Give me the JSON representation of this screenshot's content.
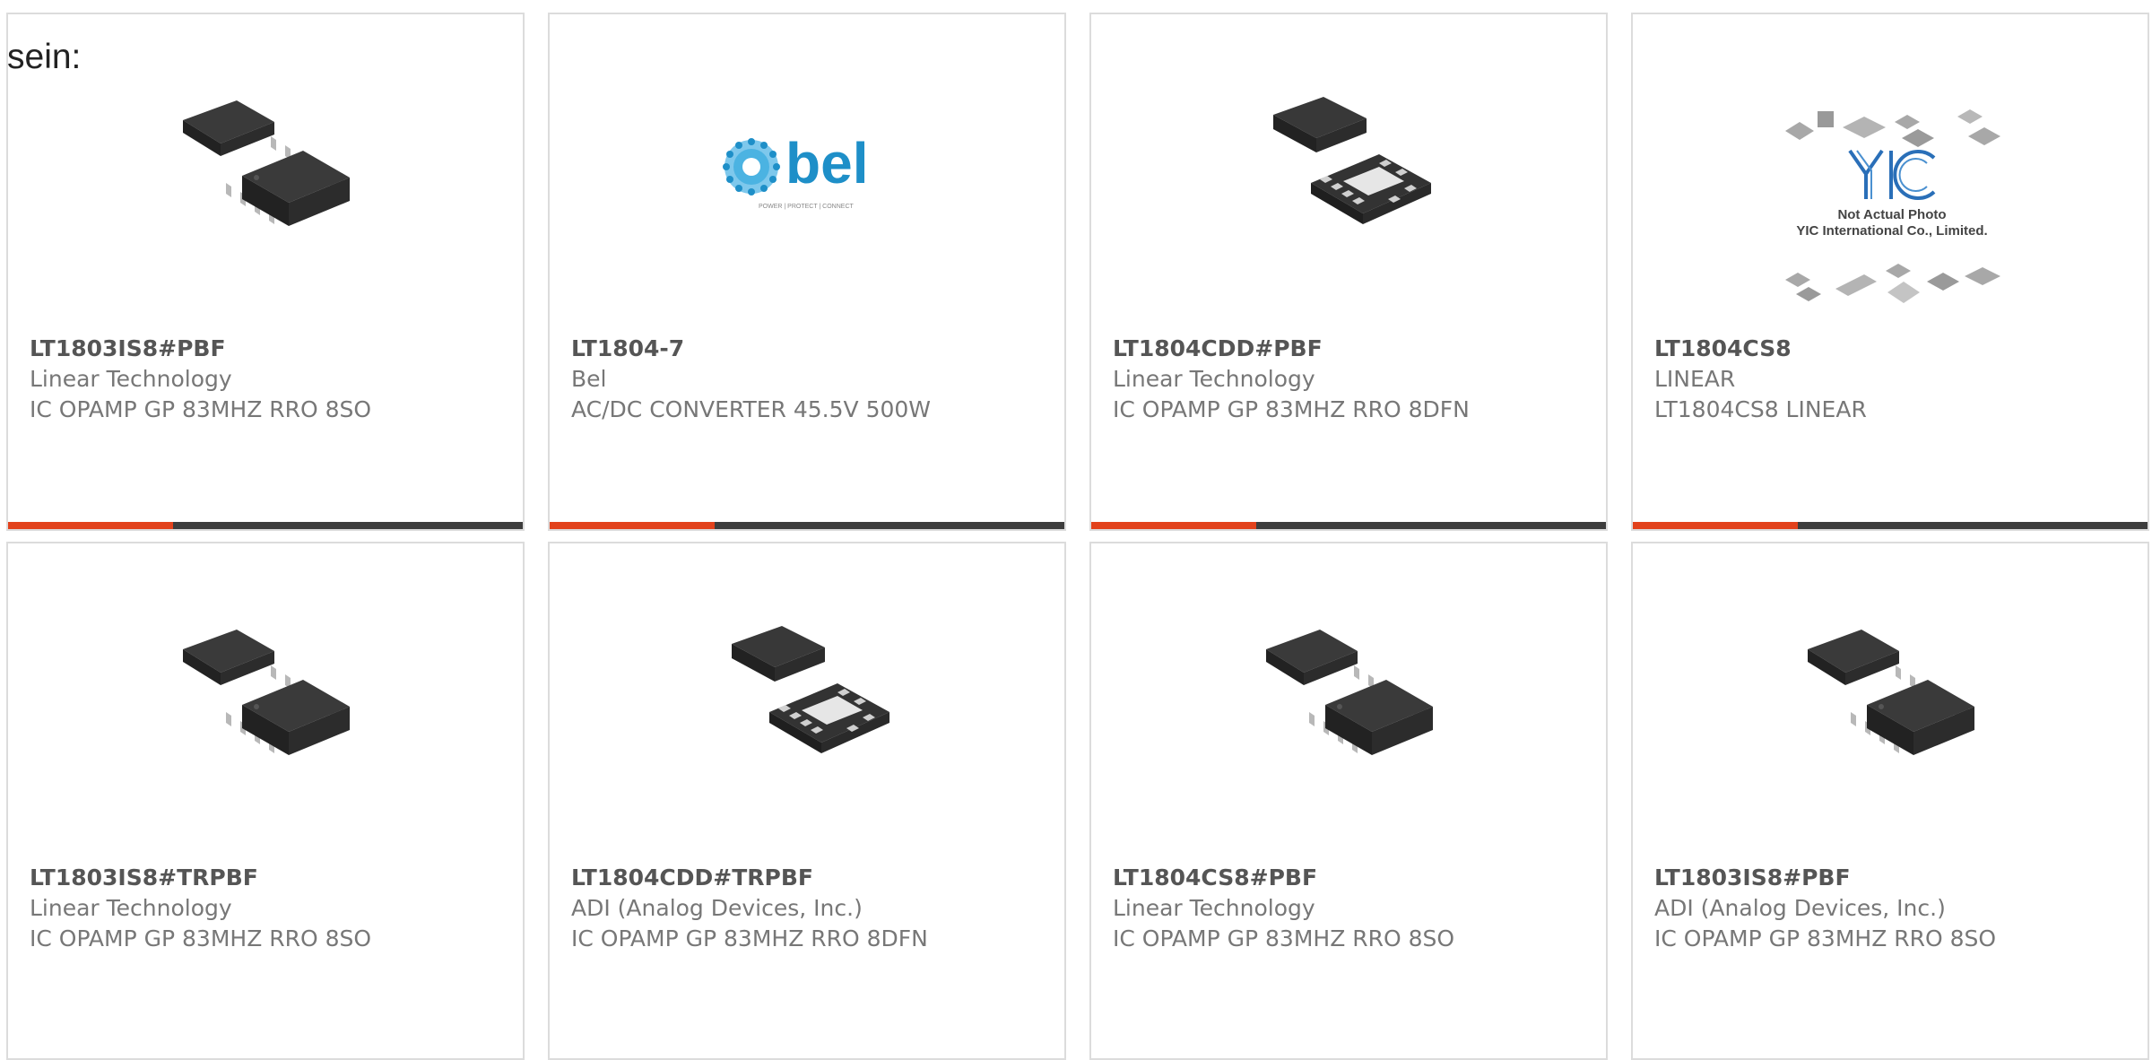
{
  "lead_text": "sein:",
  "accent_color": "#e2421c",
  "bar_color": "#3d3d3d",
  "products": [
    {
      "part": "LT1803IS8#PBF",
      "maker": "Linear Technology",
      "desc": "IC OPAMP GP 83MHZ RRO 8SO",
      "image": "soic-8-chip-icon",
      "bar_fill": 0.32
    },
    {
      "part": "LT1804-7",
      "maker": "Bel",
      "desc": "AC/DC CONVERTER 45.5V 500W",
      "image": "bel-logo",
      "logo_text": "bel",
      "logo_tagline": "POWER | PROTECT | CONNECT",
      "bar_fill": 0.32
    },
    {
      "part": "LT1804CDD#PBF",
      "maker": "Linear Technology",
      "desc": "IC OPAMP GP 83MHZ RRO 8DFN",
      "image": "dfn-8-chip-icon",
      "bar_fill": 0.32
    },
    {
      "part": "LT1804CS8",
      "maker": "LINEAR",
      "desc": "LT1804CS8 LINEAR",
      "image": "yic-placeholder-image",
      "logo_text": "YIC",
      "photo_caption_1": "Not Actual Photo",
      "photo_caption_2": "YIC International Co., Limited.",
      "bar_fill": 0.32
    },
    {
      "part": "LT1803IS8#TRPBF",
      "maker": "Linear Technology",
      "desc": "IC OPAMP GP 83MHZ RRO 8SO",
      "image": "soic-8-chip-icon"
    },
    {
      "part": "LT1804CDD#TRPBF",
      "maker": "ADI (Analog Devices, Inc.)",
      "desc": "IC OPAMP GP 83MHZ RRO 8DFN",
      "image": "dfn-8-chip-icon"
    },
    {
      "part": "LT1804CS8#PBF",
      "maker": "Linear Technology",
      "desc": "IC OPAMP GP 83MHZ RRO 8SO",
      "image": "soic-8-chip-icon"
    },
    {
      "part": "LT1803IS8#PBF",
      "maker": "ADI (Analog Devices, Inc.)",
      "desc": "IC OPAMP GP 83MHZ RRO 8SO",
      "image": "soic-8-chip-icon"
    }
  ]
}
